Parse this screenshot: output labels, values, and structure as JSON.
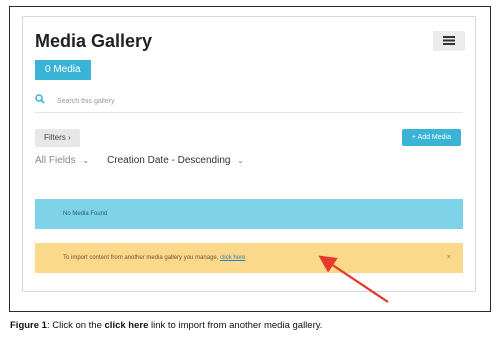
{
  "gallery": {
    "title": "Media Gallery",
    "media_count_label": "0 Media",
    "menu_icon": "list-icon"
  },
  "search": {
    "placeholder": "Search this gallery",
    "icon": "search-icon"
  },
  "toolbar": {
    "filters_label": "Filters",
    "filters_chevron": "›",
    "add_media_label": "+ Add Media"
  },
  "sort": {
    "field_label": "All Fields",
    "order_label": "Creation Date - Descending",
    "chevron": "⌄"
  },
  "notices": {
    "empty_text": "No Media Found",
    "import_prefix": "To import content from another media gallery you manage, ",
    "import_link": "click here",
    "close_glyph": "×"
  },
  "caption": {
    "label": "Figure 1",
    "text_before": ": Click on the ",
    "bold_text": "click here",
    "text_after": " link to import from another media gallery."
  },
  "colors": {
    "accent": "#3ab4d6",
    "info_bg": "#7fd3e8",
    "warning_bg": "#fbd98a",
    "arrow": "#e53a2a"
  }
}
